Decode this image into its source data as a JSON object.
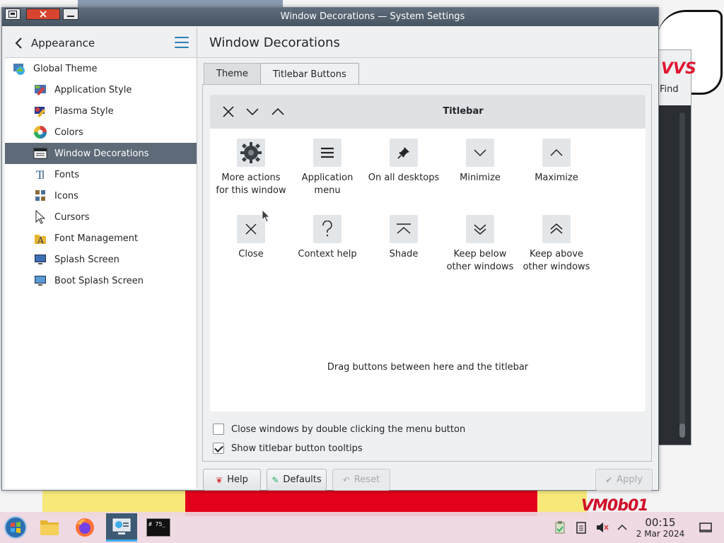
{
  "window": {
    "title": "Window Decorations — System Settings"
  },
  "sidebar": {
    "header": "Appearance",
    "items": [
      {
        "label": "Global Theme",
        "icon": "global-theme-icon"
      },
      {
        "label": "Application Style",
        "icon": "application-style-icon"
      },
      {
        "label": "Plasma Style",
        "icon": "plasma-style-icon"
      },
      {
        "label": "Colors",
        "icon": "colors-icon"
      },
      {
        "label": "Window Decorations",
        "icon": "window-decorations-icon",
        "selected": true
      },
      {
        "label": "Fonts",
        "icon": "fonts-icon"
      },
      {
        "label": "Icons",
        "icon": "icons-icon"
      },
      {
        "label": "Cursors",
        "icon": "cursors-icon"
      },
      {
        "label": "Font Management",
        "icon": "font-management-icon"
      },
      {
        "label": "Splash Screen",
        "icon": "splash-screen-icon"
      },
      {
        "label": "Boot Splash Screen",
        "icon": "boot-splash-screen-icon"
      }
    ]
  },
  "main": {
    "title": "Window Decorations",
    "tabs": [
      {
        "label": "Theme",
        "active": false
      },
      {
        "label": "Titlebar Buttons",
        "active": true
      }
    ],
    "preview": {
      "title": "Titlebar",
      "buttons": [
        "close-icon",
        "minimize-icon",
        "maximize-icon"
      ]
    },
    "pool": [
      {
        "label1": "More actions",
        "label2": "for this window",
        "icon": "gear-icon"
      },
      {
        "label1": "Application",
        "label2": "menu",
        "icon": "hamburger-menu-icon"
      },
      {
        "label1": "On all desktops",
        "label2": "",
        "icon": "pin-icon"
      },
      {
        "label1": "Minimize",
        "label2": "",
        "icon": "chevron-down-icon"
      },
      {
        "label1": "Maximize",
        "label2": "",
        "icon": "chevron-up-icon"
      },
      {
        "label1": "Close",
        "label2": "",
        "icon": "close-icon"
      },
      {
        "label1": "Context help",
        "label2": "",
        "icon": "question-icon"
      },
      {
        "label1": "Shade",
        "label2": "",
        "icon": "shade-icon"
      },
      {
        "label1": "Keep below",
        "label2": "other windows",
        "icon": "keep-below-icon"
      },
      {
        "label1": "Keep above",
        "label2": "other windows",
        "icon": "keep-above-icon"
      }
    ],
    "hint": "Drag buttons between here and the titlebar",
    "options": [
      {
        "label": "Close windows by double clicking the menu button",
        "checked": false
      },
      {
        "label": "Show titlebar button tooltips",
        "checked": true
      }
    ]
  },
  "footer": {
    "help": "Help",
    "defaults": "Defaults",
    "reset": "Reset",
    "apply": "Apply"
  },
  "background_window": {
    "brand": "VVS",
    "find": "Find"
  },
  "desktop": {
    "watermark": "VM0b01"
  },
  "taskbar": {
    "time": "00:15",
    "date": "2 Mar 2024",
    "apps": [
      "start-menu-icon",
      "file-manager-icon",
      "firefox-icon",
      "system-settings-icon",
      "terminal-icon"
    ],
    "terminal_text": "# 75_",
    "tray": [
      "clipboard-icon",
      "notes-icon",
      "volume-muted-icon",
      "expand-tray-icon",
      "show-desktop-icon"
    ]
  },
  "colors": {
    "selection": "#5e6a78",
    "accent": "#2980b9",
    "titlebar": "#475462"
  }
}
